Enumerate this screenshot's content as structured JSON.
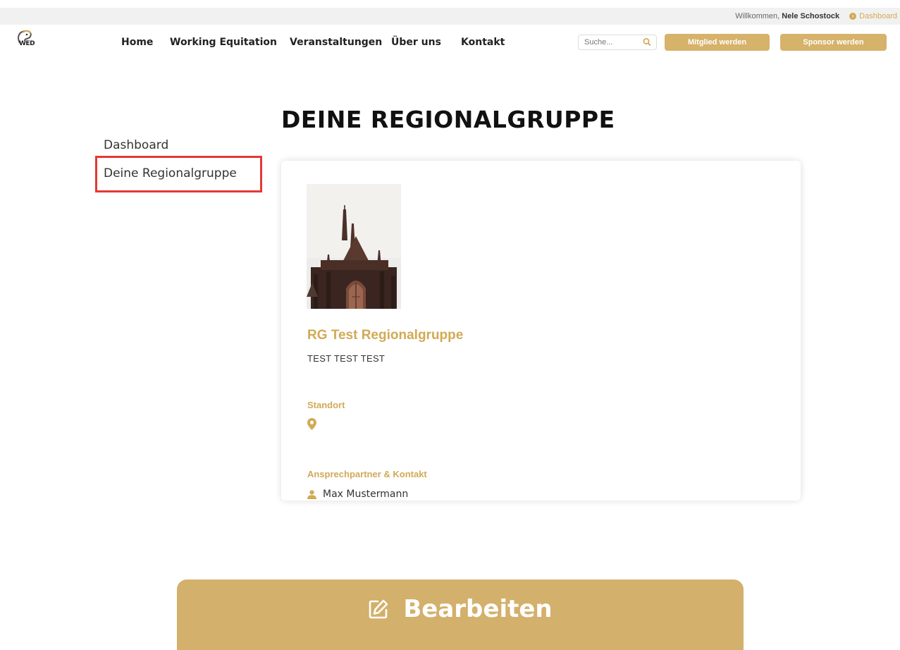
{
  "topbar": {
    "welcome_prefix": "Willkommen, ",
    "user_name": "Nele Schostock",
    "dashboard_link": "Dashboard"
  },
  "logo": {
    "text": "WED"
  },
  "nav": {
    "items": [
      "Home",
      "Working Equitation",
      "Veranstaltungen",
      "Über uns",
      "Kontakt"
    ],
    "search_placeholder": "Suche...",
    "member_button": "Mitglied werden",
    "sponsor_button": "Sponsor werden"
  },
  "page": {
    "title": "DEINE REGIONALGRUPPE"
  },
  "sidebar": {
    "items": [
      {
        "label": "Dashboard",
        "active": false
      },
      {
        "label": "Deine Regionalgruppe",
        "active": true
      }
    ]
  },
  "group": {
    "name": "RG Test Regionalgruppe",
    "description": "TEST TEST TEST",
    "location_label": "Standort",
    "contact_label": "Ansprechpartner & Kontakt",
    "contact_name": "Max Mustermann"
  },
  "edit_button": {
    "label": "Bearbeiten",
    "icon": "edit-icon"
  },
  "colors": {
    "accent": "#d1aa55",
    "highlight": "#e53935"
  }
}
